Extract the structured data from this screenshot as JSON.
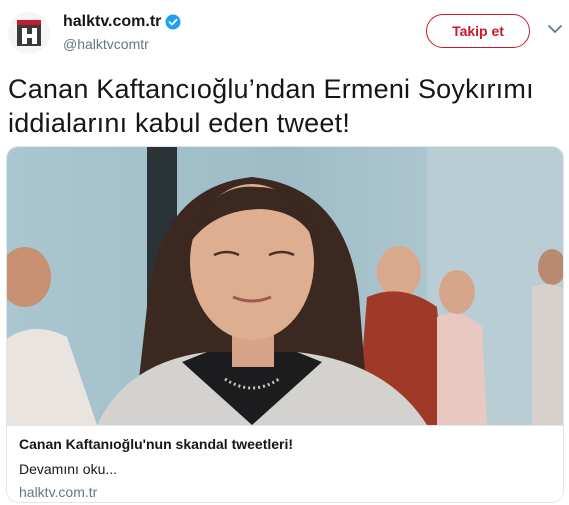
{
  "account": {
    "display_name": "halktv.com.tr",
    "handle": "@halktvcomtr",
    "verified_icon": "verified-badge-icon",
    "avatar_icon": "halktv-logo"
  },
  "follow_button": {
    "label": "Takip et"
  },
  "menu": {
    "icon": "chevron-down-icon"
  },
  "tweet": {
    "line1": "Canan Kaftancıoğlu’ndan Ermeni Soykırımı",
    "line2": "iddialarını kabul eden tweet!"
  },
  "card": {
    "title": "Canan Kaftanıoğlu'nun skandal tweetleri!",
    "description": "Devamını oku...",
    "domain": "halktv.com.tr"
  },
  "colors": {
    "brand_red": "#c8192d",
    "text": "#14171a",
    "secondary": "#657786",
    "verified_blue": "#1da1f2",
    "border": "#e1e8ed"
  }
}
